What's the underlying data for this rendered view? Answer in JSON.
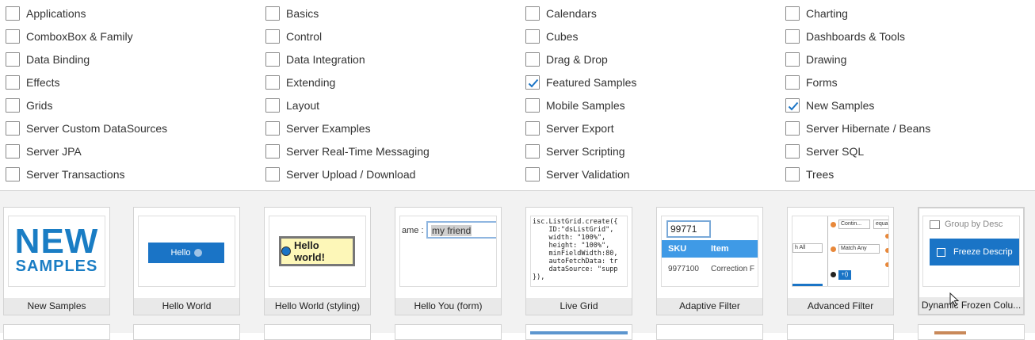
{
  "filters": {
    "categories": [
      {
        "label": "Applications",
        "checked": false
      },
      {
        "label": "Basics",
        "checked": false
      },
      {
        "label": "Calendars",
        "checked": false
      },
      {
        "label": "Charting",
        "checked": false
      },
      {
        "label": "ComboxBox & Family",
        "checked": false
      },
      {
        "label": "Control",
        "checked": false
      },
      {
        "label": "Cubes",
        "checked": false
      },
      {
        "label": "Dashboards & Tools",
        "checked": false
      },
      {
        "label": "Data Binding",
        "checked": false
      },
      {
        "label": "Data Integration",
        "checked": false
      },
      {
        "label": "Drag & Drop",
        "checked": false
      },
      {
        "label": "Drawing",
        "checked": false
      },
      {
        "label": "Effects",
        "checked": false
      },
      {
        "label": "Extending",
        "checked": false
      },
      {
        "label": "Featured Samples",
        "checked": true
      },
      {
        "label": "Forms",
        "checked": false
      },
      {
        "label": "Grids",
        "checked": false
      },
      {
        "label": "Layout",
        "checked": false
      },
      {
        "label": "Mobile Samples",
        "checked": false
      },
      {
        "label": "New Samples",
        "checked": true
      },
      {
        "label": "Server Custom DataSources",
        "checked": false
      },
      {
        "label": "Server Examples",
        "checked": false
      },
      {
        "label": "Server Export",
        "checked": false
      },
      {
        "label": "Server Hibernate / Beans",
        "checked": false
      },
      {
        "label": "Server JPA",
        "checked": false
      },
      {
        "label": "Server Real-Time Messaging",
        "checked": false
      },
      {
        "label": "Server Scripting",
        "checked": false
      },
      {
        "label": "Server SQL",
        "checked": false
      },
      {
        "label": "Server Transactions",
        "checked": false
      },
      {
        "label": "Server Upload / Download",
        "checked": false
      },
      {
        "label": "Server Validation",
        "checked": false
      },
      {
        "label": "Trees",
        "checked": false
      }
    ]
  },
  "colors": {
    "accent": "#1a7dc4",
    "check": "#1a74c6",
    "caption_bg": "#e9e9e9"
  },
  "gallery": {
    "tiles": [
      {
        "caption": "New Samples",
        "thumb": {
          "line1": "NEW",
          "line2": "SAMPLES"
        }
      },
      {
        "caption": "Hello World",
        "thumb": {
          "button": "Hello"
        }
      },
      {
        "caption": "Hello World (styling)",
        "thumb": {
          "button": "Hello world!"
        }
      },
      {
        "caption": "Hello You (form)",
        "thumb": {
          "label": "ame :",
          "value": "my friend"
        }
      },
      {
        "caption": "Live Grid",
        "thumb": {
          "code": [
            "isc.ListGrid.create({",
            "    ID:\"dsListGrid\",",
            "    width: \"100%\",",
            "    height: \"100%\",",
            "    minFieldWidth:80,",
            "    autoFetchData: tr",
            "    dataSource: \"supp",
            "}),"
          ]
        }
      },
      {
        "caption": "Adaptive Filter",
        "thumb": {
          "filter": "99771",
          "col1": "SKU",
          "col2": "Item",
          "cell1": "9977100",
          "cell2": "Correction F"
        }
      },
      {
        "caption": "Advanced Filter",
        "thumb": {
          "sel1": "Contin...",
          "sel2": "equal",
          "sel3": "Match Any",
          "side": "h All",
          "plus": "+()"
        }
      },
      {
        "caption": "Dynamic Frozen Colu...",
        "thumb": {
          "item1": "Group by Desc",
          "item2": "Freeze Descrip"
        }
      }
    ]
  }
}
